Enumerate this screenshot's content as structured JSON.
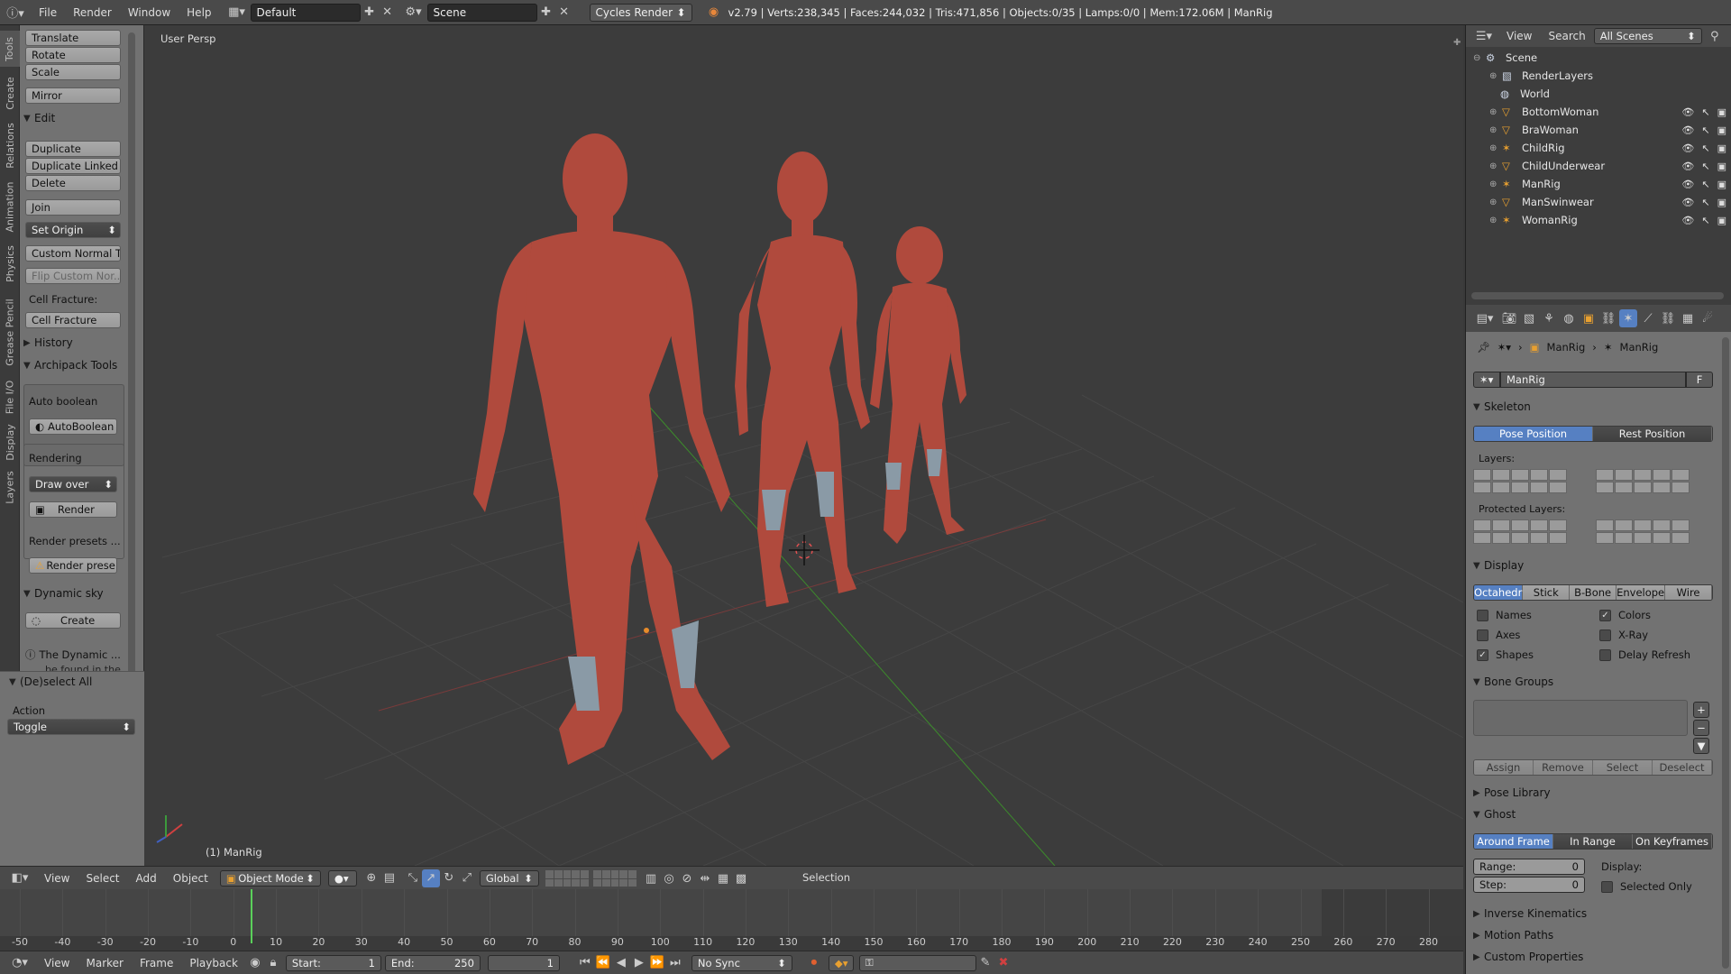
{
  "topbar": {
    "menus": [
      "File",
      "Render",
      "Window",
      "Help"
    ],
    "screen_layout": "Default",
    "scene": "Scene",
    "render_engine": "Cycles Render",
    "stats": "v2.79 | Verts:238,345 | Faces:244,032 | Tris:471,856 | Objects:0/35 | Lamps:0/0 | Mem:172.06M | ManRig"
  },
  "vtabs": [
    "Tools",
    "Create",
    "Relations",
    "Animation",
    "Physics",
    "Grease Pencil",
    "File I/O",
    "Display",
    "Layers"
  ],
  "toolshelf": {
    "transform": [
      "Translate",
      "Rotate",
      "Scale"
    ],
    "mirror": "Mirror",
    "edit_header": "Edit",
    "edit": [
      "Duplicate",
      "Duplicate Linked",
      "Delete"
    ],
    "join": "Join",
    "set_origin": "Set Origin",
    "custom_normal": "Custom Normal T...",
    "flip_custom": "Flip Custom Nor...",
    "cell_fracture_label": "Cell Fracture:",
    "cell_fracture": "Cell Fracture",
    "history": "History",
    "archipack": "Archipack Tools",
    "auto_boolean_label": "Auto boolean",
    "auto_boolean": "AutoBoolean",
    "rendering_label": "Rendering",
    "draw_over": "Draw over",
    "render": "Render",
    "render_presets_label": "Render presets ...",
    "render_presets": "Render prese...",
    "dynamic_sky": "Dynamic sky",
    "create": "Create",
    "dyn_info1": "The Dynamic ...",
    "dyn_info2": "be found in the",
    "deselect_all": "(De)select All",
    "action_label": "Action",
    "action_value": "Toggle"
  },
  "viewport": {
    "view_name": "User Persp",
    "object_label": "(1) ManRig"
  },
  "view_header": {
    "menus": [
      "View",
      "Select",
      "Add",
      "Object"
    ],
    "mode": "Object Mode",
    "orientation": "Global",
    "selection": "Selection"
  },
  "timeline": {
    "ticks": [
      "-50",
      "-40",
      "-30",
      "-20",
      "-10",
      "0",
      "10",
      "20",
      "30",
      "40",
      "50",
      "60",
      "70",
      "80",
      "90",
      "100",
      "110",
      "120",
      "130",
      "140",
      "150",
      "160",
      "170",
      "180",
      "190",
      "200",
      "210",
      "220",
      "230",
      "240",
      "250",
      "260",
      "270",
      "280"
    ],
    "current_frame_marker": 0,
    "menus": [
      "View",
      "Marker",
      "Frame",
      "Playback"
    ],
    "start_label": "Start:",
    "start": "1",
    "end_label": "End:",
    "end": "250",
    "frame": "1",
    "sync": "No Sync"
  },
  "outliner": {
    "menus": [
      "View",
      "Search"
    ],
    "filter": "All Scenes",
    "items": [
      {
        "name": "Scene",
        "icon": "scene-icon"
      },
      {
        "name": "RenderLayers",
        "icon": "renderlayers-icon"
      },
      {
        "name": "World",
        "icon": "world-icon"
      },
      {
        "name": "BottomWoman",
        "icon": "mesh-icon"
      },
      {
        "name": "BraWoman",
        "icon": "mesh-icon"
      },
      {
        "name": "ChildRig",
        "icon": "armature-icon"
      },
      {
        "name": "ChildUnderwear",
        "icon": "mesh-icon"
      },
      {
        "name": "ManRig",
        "icon": "armature-icon"
      },
      {
        "name": "ManSwinwear",
        "icon": "mesh-icon"
      },
      {
        "name": "WomanRig",
        "icon": "armature-icon"
      }
    ]
  },
  "properties": {
    "breadcrumb_object": "ManRig",
    "breadcrumb_data": "ManRig",
    "datablock_name": "ManRig",
    "fake_user": "F",
    "skeleton": "Skeleton",
    "pose_position": "Pose Position",
    "rest_position": "Rest Position",
    "layers_label": "Layers:",
    "protected_layers_label": "Protected Layers:",
    "display": "Display",
    "display_types": [
      "Octahedr",
      "Stick",
      "B-Bone",
      "Envelope",
      "Wire"
    ],
    "checks": [
      {
        "label": "Names",
        "checked": false
      },
      {
        "label": "Colors",
        "checked": true
      },
      {
        "label": "Axes",
        "checked": false
      },
      {
        "label": "X-Ray",
        "checked": false
      },
      {
        "label": "Shapes",
        "checked": true
      },
      {
        "label": "Delay Refresh",
        "checked": false
      }
    ],
    "bone_groups": "Bone Groups",
    "bone_group_buttons": [
      "Assign",
      "Remove",
      "Select",
      "Deselect"
    ],
    "pose_library": "Pose Library",
    "ghost": "Ghost",
    "ghost_types": [
      "Around Frame",
      "In Range",
      "On Keyframes"
    ],
    "range_label": "Range:",
    "range_value": "0",
    "step_label": "Step:",
    "step_value": "0",
    "ghost_display_label": "Display:",
    "selected_only": "Selected Only",
    "inverse_kinematics": "Inverse Kinematics",
    "motion_paths": "Motion Paths",
    "custom_properties": "Custom Properties"
  },
  "colors": {
    "skin": "#b04a3d",
    "accent": "#5680c2",
    "grid_green": "#3c8a2c",
    "grid_red": "#8a3a3a"
  }
}
